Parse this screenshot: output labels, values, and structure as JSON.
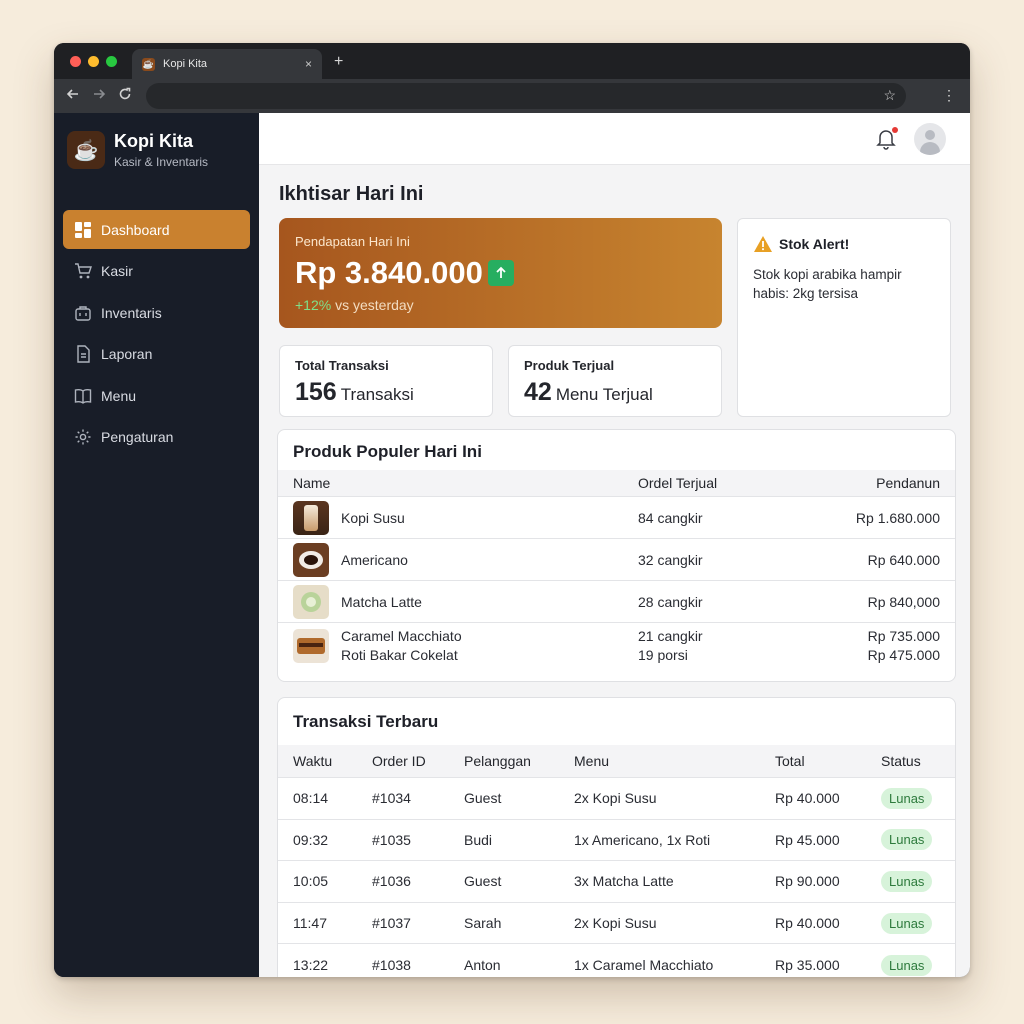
{
  "browser": {
    "tab_title": "Kopi Kita",
    "tab_close": "×",
    "new_tab": "+"
  },
  "sidebar": {
    "brand_name": "Kopi Kita",
    "brand_sub": "Kasir & Inventaris",
    "items": [
      {
        "label": "Dashboard",
        "icon": "dashboard-icon",
        "active": true
      },
      {
        "label": "Kasir",
        "icon": "cart-icon",
        "active": false
      },
      {
        "label": "Inventaris",
        "icon": "box-icon",
        "active": false
      },
      {
        "label": "Laporan",
        "icon": "document-icon",
        "active": false
      },
      {
        "label": "Menu",
        "icon": "book-icon",
        "active": false
      },
      {
        "label": "Pengaturan",
        "icon": "gear-icon",
        "active": false
      }
    ]
  },
  "main": {
    "title": "Ikhtisar Hari Ini",
    "revenue": {
      "label": "Pendapatan Hari Ini",
      "value": "Rp 3.840.000",
      "trend_pct": "+12%",
      "trend_text": " vs yesterday"
    },
    "stats": [
      {
        "label": "Total Transaksi",
        "value": "156",
        "unit": "Transaksi"
      },
      {
        "label": "Produk Terjual",
        "value": "42",
        "unit": "Menu Terjual"
      }
    ],
    "alert": {
      "title": "Stok Alert!",
      "text": "Stok kopi arabika hampir habis: 2kg tersisa"
    },
    "popular": {
      "title": "Produk Populer Hari Ini",
      "headers": [
        "Name",
        "Ordel Terjual",
        "Pendanun"
      ],
      "rows": [
        {
          "names": [
            "Kopi Susu"
          ],
          "orders": [
            "84 cangkir"
          ],
          "revenue": [
            "Rp 1.680.000"
          ]
        },
        {
          "names": [
            "Americano"
          ],
          "orders": [
            "32 cangkir"
          ],
          "revenue": [
            "Rp 640.000"
          ]
        },
        {
          "names": [
            "Matcha Latte"
          ],
          "orders": [
            "28 cangkir"
          ],
          "revenue": [
            "Rp 840,000"
          ]
        },
        {
          "names": [
            "Caramel Macchiato",
            "Roti Bakar Cokelat"
          ],
          "orders": [
            "21 cangkir",
            "19 porsi"
          ],
          "revenue": [
            "Rp 735.000",
            "Rp 475.000"
          ]
        }
      ]
    },
    "transactions": {
      "title": "Transaksi Terbaru",
      "headers": [
        "Waktu",
        "Order ID",
        "Pelanggan",
        "Menu",
        "Total",
        "Status"
      ],
      "rows": [
        [
          "08:14",
          "#1034",
          "Guest",
          "2x Kopi Susu",
          "Rp 40.000",
          "Lunas"
        ],
        [
          "09:32",
          "#1035",
          "Budi",
          "1x Americano, 1x Roti",
          "Rp 45.000",
          "Lunas"
        ],
        [
          "10:05",
          "#1036",
          "Guest",
          "3x Matcha Latte",
          "Rp 90.000",
          "Lunas"
        ],
        [
          "11:47",
          "#1037",
          "Sarah",
          "2x Kopi Susu",
          "Rp 40.000",
          "Lunas"
        ],
        [
          "13:22",
          "#1038",
          "Anton",
          "1x Caramel Macchiato",
          "Rp 35.000",
          "Lunas"
        ]
      ]
    }
  },
  "colors": {
    "accent": "#c9812f",
    "sidebar_bg": "#181d28",
    "success": "#27ae60",
    "badge_bg": "#d7f3da"
  }
}
